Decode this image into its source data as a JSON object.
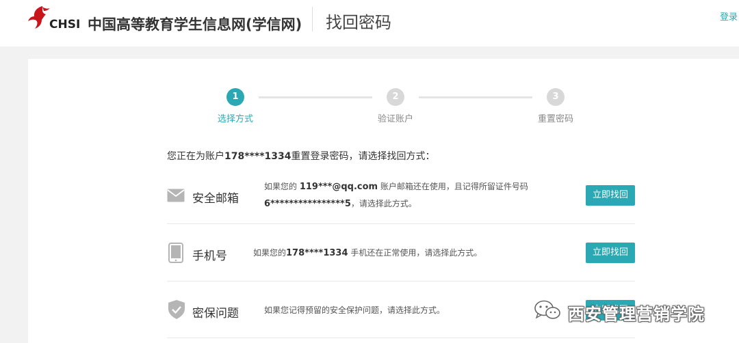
{
  "header": {
    "logo_text": "CHSI",
    "site_name": "中国高等教育学生信息网(学信网)",
    "page_title": "找回密码",
    "login_link": "登录"
  },
  "steps": [
    {
      "number": "1",
      "label": "选择方式",
      "state": "active"
    },
    {
      "number": "2",
      "label": "验证账户",
      "state": "inactive"
    },
    {
      "number": "3",
      "label": "重置密码",
      "state": "inactive"
    }
  ],
  "instruction": {
    "prefix": "您正在为账户",
    "account": "178****1334",
    "suffix": "重置登录密码，请选择找回方式："
  },
  "options": [
    {
      "icon": "envelope-icon",
      "title": "安全邮箱",
      "desc_line1_prefix": "如果您的 ",
      "desc_line1_value": "119***@qq.com",
      "desc_line1_suffix": " 账户邮箱还在使用，且记得所留证件号码",
      "desc_line2_value": "6****************5",
      "desc_line2_suffix": "，请选择此方式。",
      "button": "立即找回"
    },
    {
      "icon": "phone-icon",
      "title": "手机号",
      "desc_prefix": "如果您的",
      "desc_value": "178****1334",
      "desc_suffix": " 手机还在正常使用，请选择此方式。",
      "button": "立即找回"
    },
    {
      "icon": "shield-check-icon",
      "title": "密保问题",
      "desc": "如果您记得预留的安全保护问题，请选择此方式。",
      "button": "立即找回"
    }
  ],
  "watermark": {
    "icon": "wechat-icon",
    "text": "西安管理营销学院"
  },
  "colors": {
    "accent": "#2aa9b5",
    "logo_red": "#c8161d",
    "background": "#f2f2f2"
  }
}
